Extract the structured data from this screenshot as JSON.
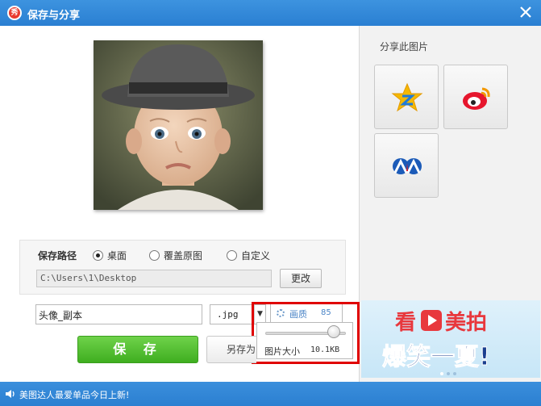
{
  "window": {
    "title": "保存与分享",
    "logo_text": "秀"
  },
  "save_path": {
    "label": "保存路径",
    "options": [
      "桌面",
      "覆盖原图",
      "自定义"
    ],
    "selected": "桌面",
    "path_value": "C:\\Users\\1\\Desktop",
    "change_label": "更改"
  },
  "file": {
    "name": "头像_副本",
    "format": ".jpg"
  },
  "quality": {
    "label": "画质",
    "value": "85",
    "slider_fraction": 0.85,
    "size_label": "图片大小",
    "size_value": "10.1KB"
  },
  "actions": {
    "save_label": "保 存",
    "save_as_label": "另存为"
  },
  "share": {
    "title": "分享此图片",
    "buttons": [
      {
        "name": "qzone",
        "icon": "qzone-star-icon",
        "color": "#f5b800"
      },
      {
        "name": "weibo",
        "icon": "weibo-icon",
        "color": "#e6162d"
      },
      {
        "name": "renren",
        "icon": "renren-icon",
        "color": "#1c5bb8"
      }
    ]
  },
  "ad": {
    "line1_a": "看",
    "line1_b": "美拍",
    "line2": "爆笑一夏!"
  },
  "status": {
    "text": "美图达人最爱单品今日上新!"
  },
  "colors": {
    "titlebar": "#2a7fd2",
    "save_green": "#4cbc2a",
    "highlight_red": "#e00000",
    "link_blue": "#4a84c6"
  }
}
